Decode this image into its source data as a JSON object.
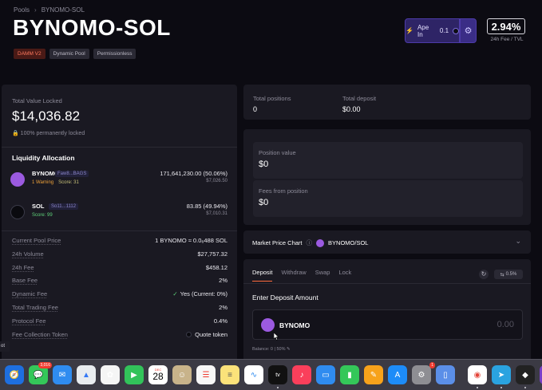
{
  "header": {
    "breadcrumb": [
      "Pools",
      "BYNOMO-SOL"
    ],
    "title": "BYNOMO-SOL",
    "tags": [
      "DAMM V2",
      "Dynamic Pool",
      "Permissionless"
    ],
    "ape_label": "Ape In",
    "ape_amount": "0.1",
    "fee_value": "2.94%",
    "fee_label": "24h Fee / TVL"
  },
  "tvl": {
    "label": "Total Value Locked",
    "value": "$14,036.82",
    "locked": "100% permanently locked"
  },
  "liquidity": {
    "title": "Liquidity Allocation",
    "tokens": [
      {
        "name": "BYNOMO",
        "addr": "Faw8...BAGS",
        "warning": "1 Warning",
        "score": "Score: 31",
        "amount": "171,641,230.00 (50.06%)",
        "usd": "$7,026.50"
      },
      {
        "name": "SOL",
        "addr": "So11...1112",
        "score": "Score: 99",
        "amount": "83.85 (49.94%)",
        "usd": "$7,010.31"
      }
    ]
  },
  "stats": [
    {
      "k": "Current Pool Price",
      "v": "1 BYNOMO ≈ 0.0₆488 SOL"
    },
    {
      "k": "24h Volume",
      "v": "$27,757.32"
    },
    {
      "k": "24h Fee",
      "v": "$458.12"
    },
    {
      "k": "Base Fee",
      "v": "2%"
    },
    {
      "k": "Dynamic Fee",
      "v": "Yes (Current: 0%)"
    },
    {
      "k": "Total Trading Fee",
      "v": "2%"
    },
    {
      "k": "Protocol Fee",
      "v": "0.4%"
    },
    {
      "k": "Fee Collection Token",
      "v": "Quote token"
    }
  ],
  "positions": {
    "total_positions_label": "Total positions",
    "total_positions": "0",
    "total_deposit_label": "Total deposit",
    "total_deposit": "$0.00",
    "position_value_label": "Position value",
    "position_value": "$0",
    "fees_label": "Fees from position",
    "fees_value": "$0"
  },
  "chart": {
    "label": "Market Price Chart",
    "pair": "BYNOMO/SOL"
  },
  "deposit": {
    "tabs": [
      "Deposit",
      "Withdraw",
      "Swap",
      "Lock"
    ],
    "slippage": "0.5%",
    "enter_label": "Enter Deposit Amount",
    "token": "BYNOMO",
    "amount": "0.00",
    "balance": "Balance: 0 | 50%"
  },
  "tooltip": "ot",
  "dock": {
    "messages_badge": "3,016",
    "calendar_month": "DEC",
    "calendar_day": "28",
    "settings_badge": "1",
    "tv_label": "tv"
  }
}
